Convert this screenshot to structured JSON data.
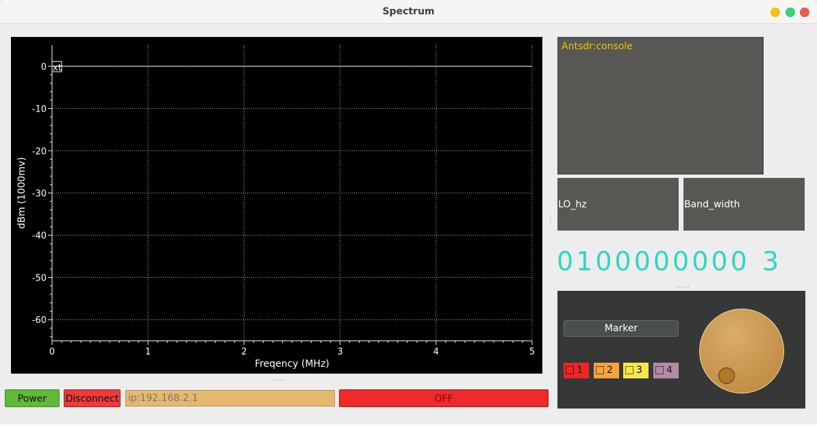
{
  "window": {
    "title": "Spectrum"
  },
  "plot": {
    "ylabel": "dBm (1000mv)",
    "xlabel": "Freqency (MHz)",
    "x_ticks": [
      "0",
      "1",
      "2",
      "3",
      "4",
      "5"
    ],
    "y_ticks": [
      "0",
      "-10",
      "-20",
      "-30",
      "-40",
      "-50",
      "-60"
    ],
    "trace_label": "xt"
  },
  "chart_data": {
    "type": "line",
    "xlabel": "Freqency (MHz)",
    "ylabel": "dBm (1000mv)",
    "xlim": [
      0,
      5
    ],
    "ylim": [
      -65,
      5
    ],
    "grid": true,
    "series": [
      {
        "name": "xt",
        "x": [
          0,
          5
        ],
        "y": [
          0,
          0
        ]
      }
    ]
  },
  "console": {
    "label": "Antsdr:console"
  },
  "lo": {
    "label": "LO_hz",
    "value": "0100000000"
  },
  "bandwidth": {
    "label": "Band_width",
    "value": "3"
  },
  "markers": {
    "button_label": "Marker",
    "items": [
      {
        "label": "1",
        "color": "#ee2528"
      },
      {
        "label": "2",
        "color": "#f4a342"
      },
      {
        "label": "3",
        "color": "#f8e64a"
      },
      {
        "label": "4",
        "color": "#b48aa8"
      }
    ]
  },
  "controls": {
    "power_label": "Power",
    "disconnect_label": "Disconnect",
    "ip_placeholder": "ip:192.168.2.1",
    "status_label": "OFF"
  },
  "colors": {
    "lcd": "#2ed6c4",
    "console_text": "#f2c200",
    "power": "#62b83a",
    "disconnect": "#ee3a3a",
    "off": "#ee2a2a",
    "ip_field": "#e6b86e"
  }
}
